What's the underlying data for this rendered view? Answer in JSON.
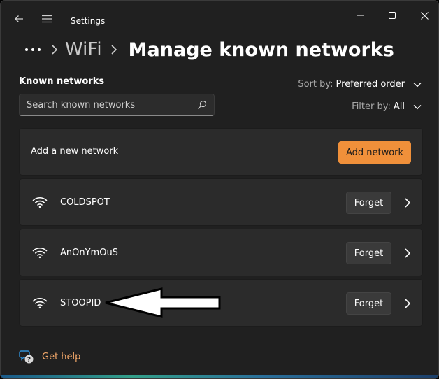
{
  "window": {
    "title": "Settings"
  },
  "breadcrumb": {
    "overflow": "...",
    "parent": "WiFi",
    "current": "Manage known networks"
  },
  "known_networks": {
    "title": "Known networks",
    "search_placeholder": "Search known networks",
    "sort_label": "Sort by:",
    "sort_value": "Preferred order",
    "filter_label": "Filter by:",
    "filter_value": "All"
  },
  "add_network": {
    "label": "Add a new network",
    "button": "Add network",
    "accent": "#f0903a"
  },
  "networks": [
    {
      "name": "COLDSPOT",
      "forget": "Forget"
    },
    {
      "name": "AnOnYmOuS",
      "forget": "Forget"
    },
    {
      "name": "STOOPID",
      "forget": "Forget"
    }
  ],
  "footer": {
    "help_label": "Get help"
  },
  "icons": {
    "back": "back-arrow-icon",
    "menu": "hamburger-icon",
    "minimize": "minimize-icon",
    "maximize": "maximize-icon",
    "close": "close-icon",
    "search": "search-icon",
    "wifi": "wifi-icon",
    "chevron": "chevron-right-icon",
    "help": "help-icon"
  }
}
